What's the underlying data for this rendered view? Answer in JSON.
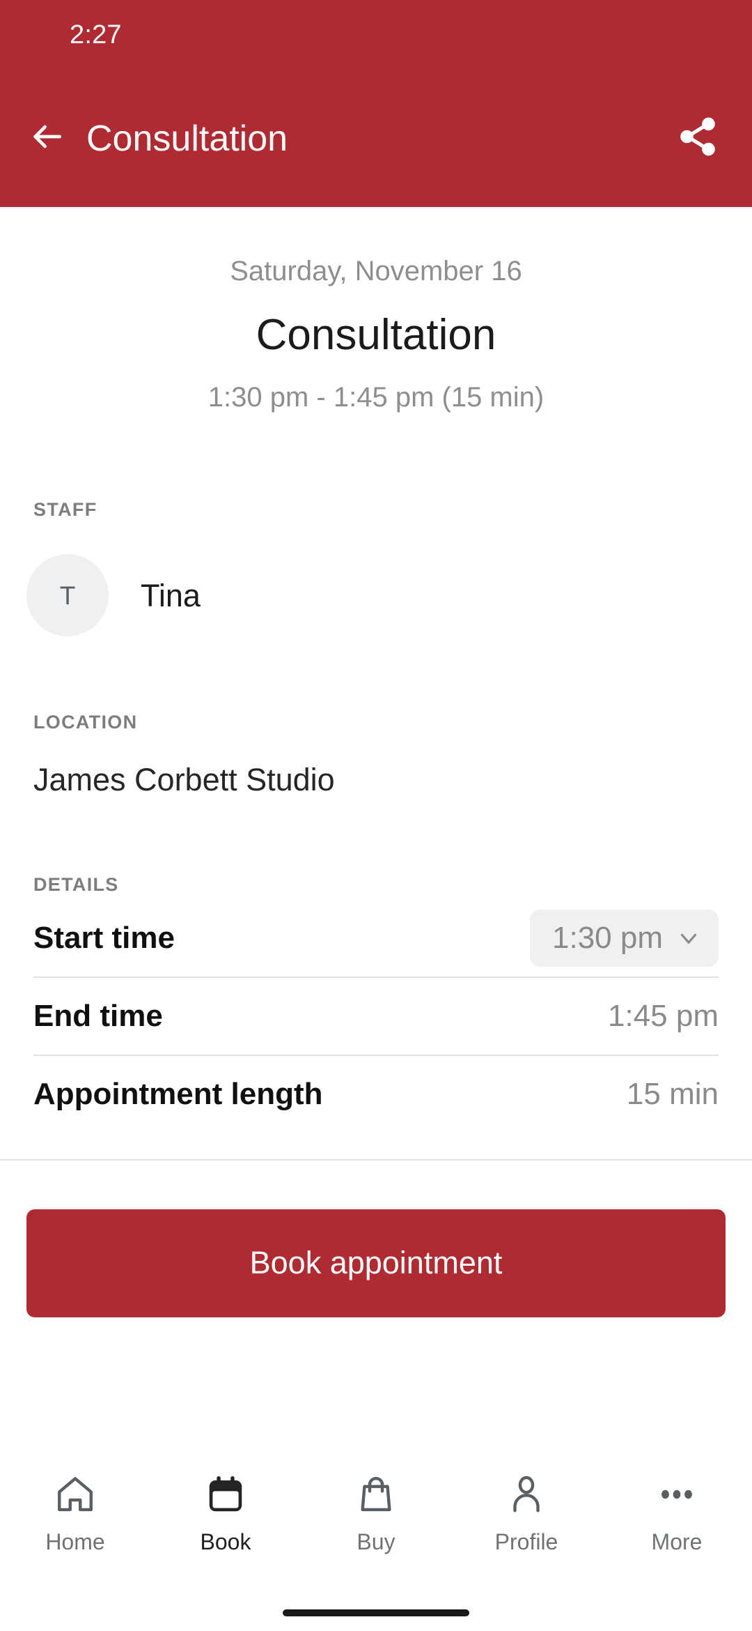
{
  "theme": {
    "brand_red": "#B02A32",
    "text_primary": "#1b1b1b",
    "text_muted": "#8e8e8e",
    "pill_bg": "#eef0f2",
    "divider": "#e2e2e2"
  },
  "status_bar": {
    "clock": "2:27"
  },
  "app_bar": {
    "back_icon": "arrow-left-icon",
    "title": "Consultation",
    "share_icon": "share-icon"
  },
  "hero": {
    "date": "Saturday, November 16",
    "service": "Consultation",
    "time_range": "1:30 pm - 1:45 pm (15 min)"
  },
  "staff": {
    "label": "STAFF",
    "avatar_initial": "T",
    "name": "Tina"
  },
  "location": {
    "label": "LOCATION",
    "value": "James Corbett Studio"
  },
  "details": {
    "label": "DETAILS",
    "rows": [
      {
        "label": "Start time",
        "value": "1:30 pm",
        "type": "dropdown",
        "chevron_icon": "chevron-down-icon"
      },
      {
        "label": "End time",
        "value": "1:45 pm",
        "type": "static"
      },
      {
        "label": "Appointment length",
        "value": "15 min",
        "type": "static"
      }
    ]
  },
  "cta": {
    "label": "Book appointment"
  },
  "bottom_nav": {
    "items": [
      {
        "label": "Home",
        "icon": "home-icon",
        "selected": false
      },
      {
        "label": "Book",
        "icon": "calendar-icon",
        "selected": true
      },
      {
        "label": "Buy",
        "icon": "bag-icon",
        "selected": false
      },
      {
        "label": "Profile",
        "icon": "person-icon",
        "selected": false
      },
      {
        "label": "More",
        "icon": "ellipsis-icon",
        "selected": false
      }
    ]
  }
}
